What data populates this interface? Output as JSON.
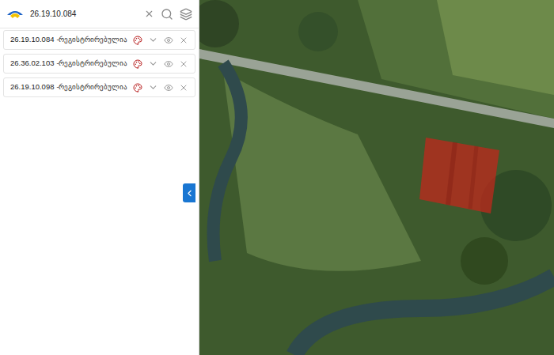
{
  "search": {
    "value": "26.19.10.084"
  },
  "layers": [
    {
      "code": "26.19.10.084",
      "status": "-რეგისტრირებულია",
      "color": "#b71c1c",
      "visible": true
    },
    {
      "code": "26.36.02.103",
      "status": "-რეგისტრირებულია",
      "color": "#b71c1c",
      "visible": true
    },
    {
      "code": "26.19.10.098",
      "status": "-რეგისტრირებულია",
      "color": "#b71c1c",
      "visible": true
    }
  ],
  "panel": {
    "expanded": true
  },
  "map": {
    "parcel": {
      "color": "#c0281c"
    }
  }
}
